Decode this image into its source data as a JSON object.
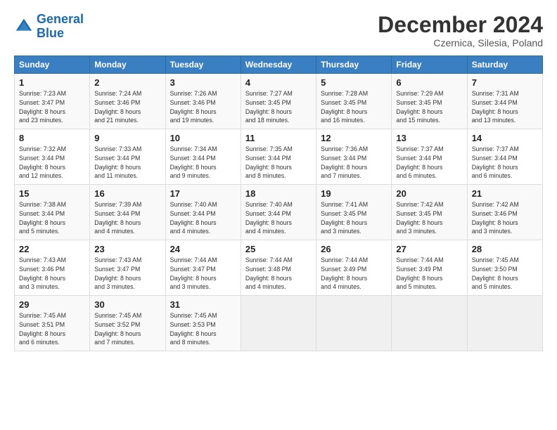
{
  "header": {
    "logo_line1": "General",
    "logo_line2": "Blue",
    "month": "December 2024",
    "location": "Czernica, Silesia, Poland"
  },
  "weekdays": [
    "Sunday",
    "Monday",
    "Tuesday",
    "Wednesday",
    "Thursday",
    "Friday",
    "Saturday"
  ],
  "weeks": [
    [
      {
        "day": "1",
        "info": "Sunrise: 7:23 AM\nSunset: 3:47 PM\nDaylight: 8 hours\nand 23 minutes."
      },
      {
        "day": "2",
        "info": "Sunrise: 7:24 AM\nSunset: 3:46 PM\nDaylight: 8 hours\nand 21 minutes."
      },
      {
        "day": "3",
        "info": "Sunrise: 7:26 AM\nSunset: 3:46 PM\nDaylight: 8 hours\nand 19 minutes."
      },
      {
        "day": "4",
        "info": "Sunrise: 7:27 AM\nSunset: 3:45 PM\nDaylight: 8 hours\nand 18 minutes."
      },
      {
        "day": "5",
        "info": "Sunrise: 7:28 AM\nSunset: 3:45 PM\nDaylight: 8 hours\nand 16 minutes."
      },
      {
        "day": "6",
        "info": "Sunrise: 7:29 AM\nSunset: 3:45 PM\nDaylight: 8 hours\nand 15 minutes."
      },
      {
        "day": "7",
        "info": "Sunrise: 7:31 AM\nSunset: 3:44 PM\nDaylight: 8 hours\nand 13 minutes."
      }
    ],
    [
      {
        "day": "8",
        "info": "Sunrise: 7:32 AM\nSunset: 3:44 PM\nDaylight: 8 hours\nand 12 minutes."
      },
      {
        "day": "9",
        "info": "Sunrise: 7:33 AM\nSunset: 3:44 PM\nDaylight: 8 hours\nand 11 minutes."
      },
      {
        "day": "10",
        "info": "Sunrise: 7:34 AM\nSunset: 3:44 PM\nDaylight: 8 hours\nand 9 minutes."
      },
      {
        "day": "11",
        "info": "Sunrise: 7:35 AM\nSunset: 3:44 PM\nDaylight: 8 hours\nand 8 minutes."
      },
      {
        "day": "12",
        "info": "Sunrise: 7:36 AM\nSunset: 3:44 PM\nDaylight: 8 hours\nand 7 minutes."
      },
      {
        "day": "13",
        "info": "Sunrise: 7:37 AM\nSunset: 3:44 PM\nDaylight: 8 hours\nand 6 minutes."
      },
      {
        "day": "14",
        "info": "Sunrise: 7:37 AM\nSunset: 3:44 PM\nDaylight: 8 hours\nand 6 minutes."
      }
    ],
    [
      {
        "day": "15",
        "info": "Sunrise: 7:38 AM\nSunset: 3:44 PM\nDaylight: 8 hours\nand 5 minutes."
      },
      {
        "day": "16",
        "info": "Sunrise: 7:39 AM\nSunset: 3:44 PM\nDaylight: 8 hours\nand 4 minutes."
      },
      {
        "day": "17",
        "info": "Sunrise: 7:40 AM\nSunset: 3:44 PM\nDaylight: 8 hours\nand 4 minutes."
      },
      {
        "day": "18",
        "info": "Sunrise: 7:40 AM\nSunset: 3:44 PM\nDaylight: 8 hours\nand 4 minutes."
      },
      {
        "day": "19",
        "info": "Sunrise: 7:41 AM\nSunset: 3:45 PM\nDaylight: 8 hours\nand 3 minutes."
      },
      {
        "day": "20",
        "info": "Sunrise: 7:42 AM\nSunset: 3:45 PM\nDaylight: 8 hours\nand 3 minutes."
      },
      {
        "day": "21",
        "info": "Sunrise: 7:42 AM\nSunset: 3:46 PM\nDaylight: 8 hours\nand 3 minutes."
      }
    ],
    [
      {
        "day": "22",
        "info": "Sunrise: 7:43 AM\nSunset: 3:46 PM\nDaylight: 8 hours\nand 3 minutes."
      },
      {
        "day": "23",
        "info": "Sunrise: 7:43 AM\nSunset: 3:47 PM\nDaylight: 8 hours\nand 3 minutes."
      },
      {
        "day": "24",
        "info": "Sunrise: 7:44 AM\nSunset: 3:47 PM\nDaylight: 8 hours\nand 3 minutes."
      },
      {
        "day": "25",
        "info": "Sunrise: 7:44 AM\nSunset: 3:48 PM\nDaylight: 8 hours\nand 4 minutes."
      },
      {
        "day": "26",
        "info": "Sunrise: 7:44 AM\nSunset: 3:49 PM\nDaylight: 8 hours\nand 4 minutes."
      },
      {
        "day": "27",
        "info": "Sunrise: 7:44 AM\nSunset: 3:49 PM\nDaylight: 8 hours\nand 5 minutes."
      },
      {
        "day": "28",
        "info": "Sunrise: 7:45 AM\nSunset: 3:50 PM\nDaylight: 8 hours\nand 5 minutes."
      }
    ],
    [
      {
        "day": "29",
        "info": "Sunrise: 7:45 AM\nSunset: 3:51 PM\nDaylight: 8 hours\nand 6 minutes."
      },
      {
        "day": "30",
        "info": "Sunrise: 7:45 AM\nSunset: 3:52 PM\nDaylight: 8 hours\nand 7 minutes."
      },
      {
        "day": "31",
        "info": "Sunrise: 7:45 AM\nSunset: 3:53 PM\nDaylight: 8 hours\nand 8 minutes."
      },
      null,
      null,
      null,
      null
    ]
  ]
}
